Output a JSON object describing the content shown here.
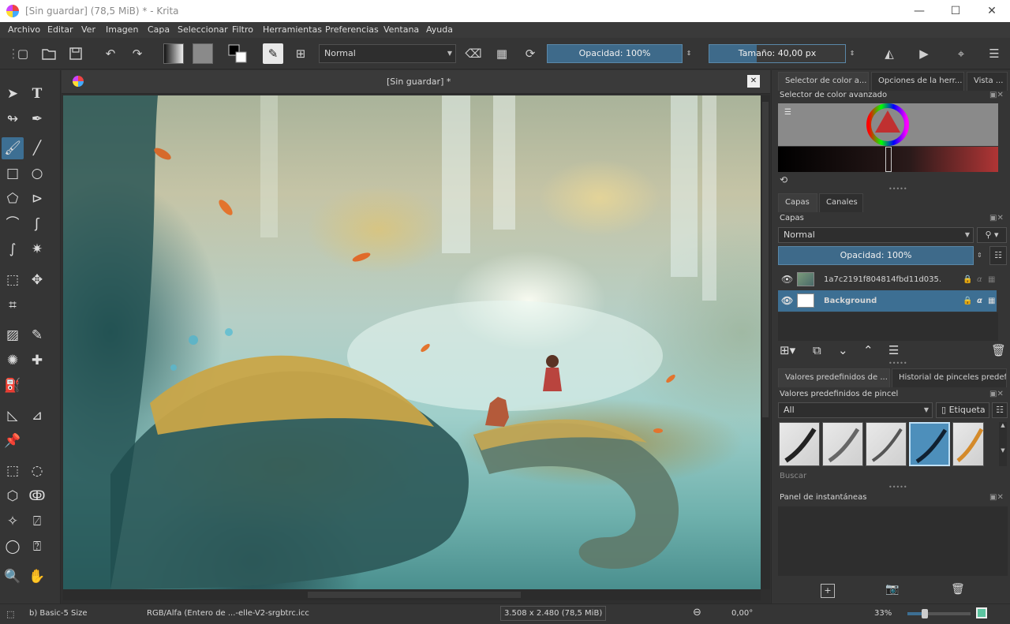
{
  "window": {
    "title": "[Sin guardar]  (78,5 MiB)  * - Krita",
    "minimize": "—",
    "maximize": "☐",
    "close": "✕"
  },
  "menu": [
    "Archivo",
    "Editar",
    "Ver",
    "Imagen",
    "Capa",
    "Seleccionar",
    "Filtro",
    "Herramientas",
    "Preferencias",
    "Ventana",
    "Ayuda"
  ],
  "toolbar": {
    "blend_mode": "Normal",
    "opacity": "Opacidad: 100%",
    "size": "Tamaño: 40,00 px"
  },
  "document": {
    "tab_title": "[Sin guardar]  *",
    "close": "✕"
  },
  "panels": {
    "tabs": [
      "Selector de color a...",
      "Opciones de la herr...",
      "Vista ..."
    ],
    "color_selector_title": "Selector de color avanzado",
    "layer_tabs": [
      "Capas",
      "Canales"
    ],
    "layers_title": "Capas",
    "layers_blend_mode": "Normal",
    "layers_opacity": "Opacidad:  100%",
    "layers": [
      {
        "name": "1a7c2191f804814fbd11d035...",
        "selected": false
      },
      {
        "name": "Background",
        "selected": true
      }
    ],
    "preset_tabs": [
      "Valores predefinidos de ...",
      "Historial de pinceles predefi..."
    ],
    "presets_title": "Valores predefinidos de pincel",
    "presets_filter": "All",
    "presets_tag": "Etiqueta",
    "presets_search": "Buscar",
    "snapshot_title": "Panel de instantáneas"
  },
  "status": {
    "brush": "b) Basic-5 Size",
    "color_profile": "RGB/Alfa (Entero de ...-elle-V2-srgbtrc.icc",
    "dimensions": "3.508 x 2.480 (78,5 MiB)",
    "rotation": "0,00°",
    "zoom": "33%"
  },
  "colors": {
    "accent": "#3d6f93",
    "background": "#313131"
  }
}
